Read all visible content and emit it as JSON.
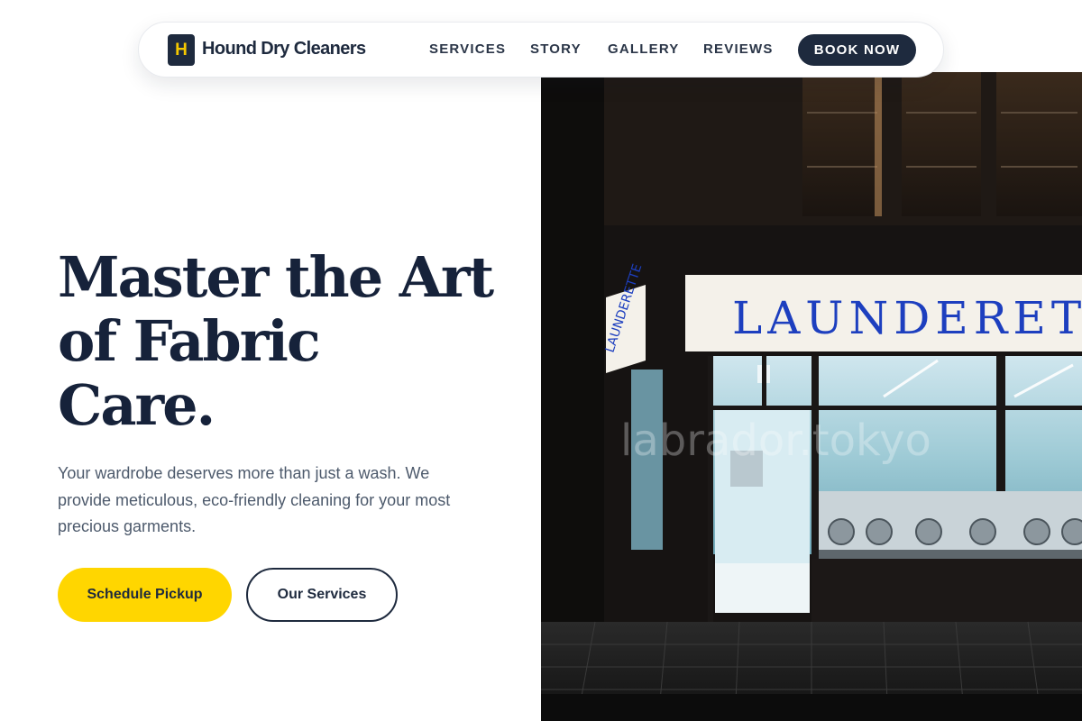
{
  "brand": {
    "logo_letter": "H",
    "name": "Hound Dry Cleaners"
  },
  "nav": {
    "links": [
      "SERVICES",
      "STORY",
      "GALLERY",
      "REVIEWS"
    ],
    "cta": "BOOK NOW"
  },
  "hero": {
    "title_lines": [
      "Master the Art",
      "of Fabric",
      "Care."
    ],
    "subtitle": "Your wardrobe deserves more than just a wash. We provide meticulous, eco-friendly cleaning for your most precious garments.",
    "primary_button": "Schedule Pickup",
    "secondary_button": "Our Services"
  },
  "image": {
    "sign_text": "LAUNDERETTE",
    "watermark": "labrador.tokyo"
  },
  "colors": {
    "navy": "#1e2a3e",
    "accent_yellow": "#ffd600",
    "body_text": "#4d5a6c",
    "sign_blue": "#1d3fbf"
  }
}
